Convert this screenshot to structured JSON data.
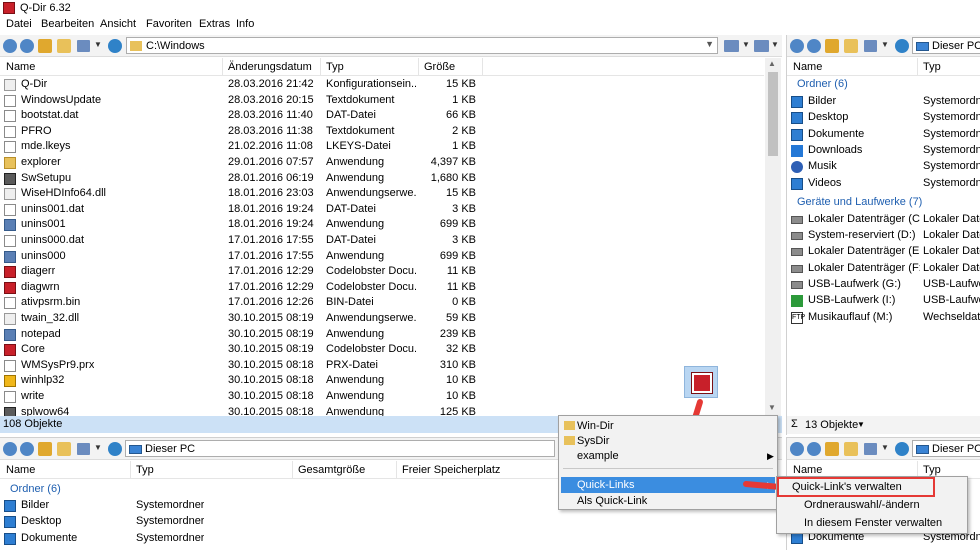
{
  "window": {
    "title": "Q-Dir 6.32"
  },
  "menu": [
    "Datei",
    "Bearbeiten",
    "Ansicht",
    "Favoriten",
    "Extras",
    "Info"
  ],
  "pane_tl": {
    "path": "C:\\Windows",
    "columns": [
      "Name",
      "Änderungsdatum",
      "Typ",
      "Größe"
    ],
    "rows": [
      {
        "name": "Q-Dir",
        "date": "28.03.2016 21:42",
        "type": "Konfigurationsein...",
        "size": "15 KB",
        "icon": "settings-file-icon"
      },
      {
        "name": "WindowsUpdate",
        "date": "28.03.2016 20:15",
        "type": "Textdokument",
        "size": "1 KB",
        "icon": "text-file-icon"
      },
      {
        "name": "bootstat.dat",
        "date": "28.03.2016 11:40",
        "type": "DAT-Datei",
        "size": "66 KB",
        "icon": "file-icon"
      },
      {
        "name": "PFRO",
        "date": "28.03.2016 11:38",
        "type": "Textdokument",
        "size": "2 KB",
        "icon": "text-file-icon"
      },
      {
        "name": "mde.lkeys",
        "date": "21.02.2016 11:08",
        "type": "LKEYS-Datei",
        "size": "1 KB",
        "icon": "file-icon"
      },
      {
        "name": "explorer",
        "date": "29.01.2016 07:57",
        "type": "Anwendung",
        "size": "4,397 KB",
        "icon": "explorer-icon"
      },
      {
        "name": "SwSetupu",
        "date": "28.01.2016 06:19",
        "type": "Anwendung",
        "size": "1,680 KB",
        "icon": "setup-icon"
      },
      {
        "name": "WiseHDInfo64.dll",
        "date": "18.01.2016 23:03",
        "type": "Anwendungserwe...",
        "size": "15 KB",
        "icon": "dll-icon"
      },
      {
        "name": "unins001.dat",
        "date": "18.01.2016 19:24",
        "type": "DAT-Datei",
        "size": "3 KB",
        "icon": "file-icon"
      },
      {
        "name": "unins001",
        "date": "18.01.2016 19:24",
        "type": "Anwendung",
        "size": "699 KB",
        "icon": "uninstaller-icon"
      },
      {
        "name": "unins000.dat",
        "date": "17.01.2016 17:55",
        "type": "DAT-Datei",
        "size": "3 KB",
        "icon": "file-icon"
      },
      {
        "name": "unins000",
        "date": "17.01.2016 17:55",
        "type": "Anwendung",
        "size": "699 KB",
        "icon": "uninstaller-icon"
      },
      {
        "name": "diagerr",
        "date": "17.01.2016 12:29",
        "type": "Codelobster Docu...",
        "size": "11 KB",
        "icon": "codelobster-icon"
      },
      {
        "name": "diagwrn",
        "date": "17.01.2016 12:29",
        "type": "Codelobster Docu...",
        "size": "11 KB",
        "icon": "codelobster-icon"
      },
      {
        "name": "ativpsrm.bin",
        "date": "17.01.2016 12:26",
        "type": "BIN-Datei",
        "size": "0 KB",
        "icon": "file-icon"
      },
      {
        "name": "twain_32.dll",
        "date": "30.10.2015 08:19",
        "type": "Anwendungserwe...",
        "size": "59 KB",
        "icon": "dll-icon"
      },
      {
        "name": "notepad",
        "date": "30.10.2015 08:19",
        "type": "Anwendung",
        "size": "239 KB",
        "icon": "notepad-icon"
      },
      {
        "name": "Core",
        "date": "30.10.2015 08:19",
        "type": "Codelobster Docu...",
        "size": "32 KB",
        "icon": "codelobster-icon"
      },
      {
        "name": "WMSysPr9.prx",
        "date": "30.10.2015 08:18",
        "type": "PRX-Datei",
        "size": "310 KB",
        "icon": "file-icon"
      },
      {
        "name": "winhlp32",
        "date": "30.10.2015 08:18",
        "type": "Anwendung",
        "size": "10 KB",
        "icon": "help-icon"
      },
      {
        "name": "write",
        "date": "30.10.2015 08:18",
        "type": "Anwendung",
        "size": "10 KB",
        "icon": "write-icon"
      },
      {
        "name": "splwow64",
        "date": "30.10.2015 08:18",
        "type": "Anwendung",
        "size": "125 KB",
        "icon": "printer-icon"
      }
    ],
    "status": "108 Objekte"
  },
  "pane_tr": {
    "path": "Dieser PC",
    "columns": [
      "Name",
      "Typ"
    ],
    "groups": [
      {
        "header": "Ordner (6)",
        "items": [
          {
            "name": "Bilder",
            "type": "Systemordner",
            "icon": "pictures-folder-icon"
          },
          {
            "name": "Desktop",
            "type": "Systemordner",
            "icon": "desktop-folder-icon"
          },
          {
            "name": "Dokumente",
            "type": "Systemordner",
            "icon": "documents-folder-icon"
          },
          {
            "name": "Downloads",
            "type": "Systemordner",
            "icon": "downloads-folder-icon"
          },
          {
            "name": "Musik",
            "type": "Systemordner",
            "icon": "music-folder-icon"
          },
          {
            "name": "Videos",
            "type": "Systemordner",
            "icon": "videos-folder-icon"
          }
        ]
      },
      {
        "header": "Geräte und Laufwerke (7)",
        "items": [
          {
            "name": "Lokaler Datenträger (C:)",
            "type": "Lokaler Daten",
            "icon": "drive-icon"
          },
          {
            "name": "System-reserviert (D:)",
            "type": "Lokaler Daten",
            "icon": "drive-icon"
          },
          {
            "name": "Lokaler Datenträger (E:)",
            "type": "Lokaler Daten",
            "icon": "drive-icon"
          },
          {
            "name": "Lokaler Datenträger (F:)",
            "type": "Lokaler Daten",
            "icon": "drive-icon"
          },
          {
            "name": "USB-Laufwerk (G:)",
            "type": "USB-Laufwerk",
            "icon": "usb-drive-icon"
          },
          {
            "name": "USB-Laufwerk (I:)",
            "type": "USB-Laufwerk",
            "icon": "usb-drive-x-icon"
          },
          {
            "name": "Musikauflauf (M:)",
            "type": "Wechseldater",
            "icon": "ftp-drive-icon"
          }
        ]
      }
    ],
    "status": "13 Objekte"
  },
  "pane_bl": {
    "path": "Dieser PC",
    "columns": [
      "Name",
      "Typ",
      "Gesamtgröße",
      "Freier Speicherplatz"
    ],
    "group_header": "Ordner (6)",
    "items": [
      {
        "name": "Bilder",
        "type": "Systemordner",
        "icon": "pictures-folder-icon"
      },
      {
        "name": "Desktop",
        "type": "Systemordner",
        "icon": "desktop-folder-icon"
      },
      {
        "name": "Dokumente",
        "type": "Systemordner",
        "icon": "documents-folder-icon"
      }
    ]
  },
  "pane_br": {
    "path": "Dieser PC",
    "columns": [
      "Name",
      "Typ"
    ],
    "items": [
      {
        "name": "Dokumente",
        "type": "Systemordner",
        "icon": "documents-folder-icon"
      }
    ]
  },
  "context_menu": {
    "items": [
      {
        "label": "Win-Dir",
        "icon": "folder-icon"
      },
      {
        "label": "SysDir",
        "icon": "folder-icon"
      },
      {
        "label": "example",
        "icon": ""
      }
    ],
    "quick_links": "Quick-Links",
    "as_quick_link": "Als Quick-Link"
  },
  "submenu": {
    "items": [
      "Quick-Link's verwalten",
      "Ordnerauswahl/-ändern",
      "In diesem Fenster verwalten"
    ]
  },
  "colors": {
    "accent": "#3b8de0",
    "status_bg": "#cce1f6",
    "highlight_red": "#e53935",
    "group_header": "#1f5fb0"
  }
}
